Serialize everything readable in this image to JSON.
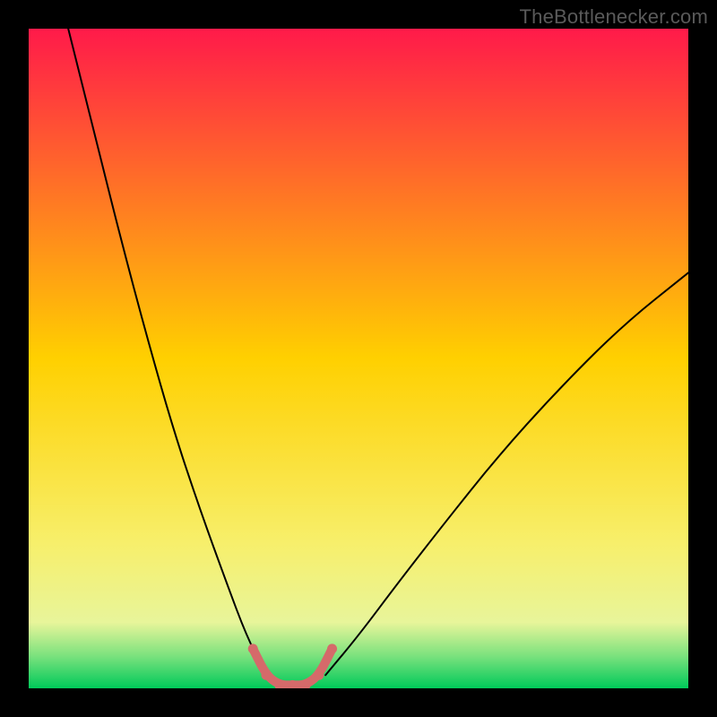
{
  "watermark": {
    "text": "TheBottlenecker.com"
  },
  "chart_data": {
    "type": "line",
    "title": "",
    "xlabel": "",
    "ylabel": "",
    "xlim": [
      0,
      100
    ],
    "ylim": [
      0,
      100
    ],
    "grid": false,
    "background_gradient": {
      "stops": [
        {
          "offset": 0.0,
          "color": "#ff1a4a"
        },
        {
          "offset": 0.5,
          "color": "#ffd000"
        },
        {
          "offset": 0.78,
          "color": "#f7ef6b"
        },
        {
          "offset": 0.9,
          "color": "#e8f59a"
        },
        {
          "offset": 0.95,
          "color": "#7de27e"
        },
        {
          "offset": 1.0,
          "color": "#00c95a"
        }
      ]
    },
    "series": [
      {
        "name": "bottleneck-left",
        "x": [
          6,
          10,
          14,
          18,
          22,
          26,
          30,
          33,
          36
        ],
        "y": [
          100,
          84,
          68,
          53,
          39,
          27,
          16,
          8,
          2
        ],
        "stroke": "#000000",
        "width": 2
      },
      {
        "name": "bottleneck-right",
        "x": [
          45,
          50,
          56,
          63,
          71,
          80,
          90,
          100
        ],
        "y": [
          2,
          8,
          16,
          25,
          35,
          45,
          55,
          63
        ],
        "stroke": "#000000",
        "width": 2
      },
      {
        "name": "optimal-band",
        "x": [
          34,
          36,
          38,
          40,
          42,
          44,
          46
        ],
        "y": [
          6,
          2,
          0.5,
          0.5,
          0.5,
          2,
          6
        ],
        "stroke": "#d56a6a",
        "width": 10
      }
    ]
  }
}
